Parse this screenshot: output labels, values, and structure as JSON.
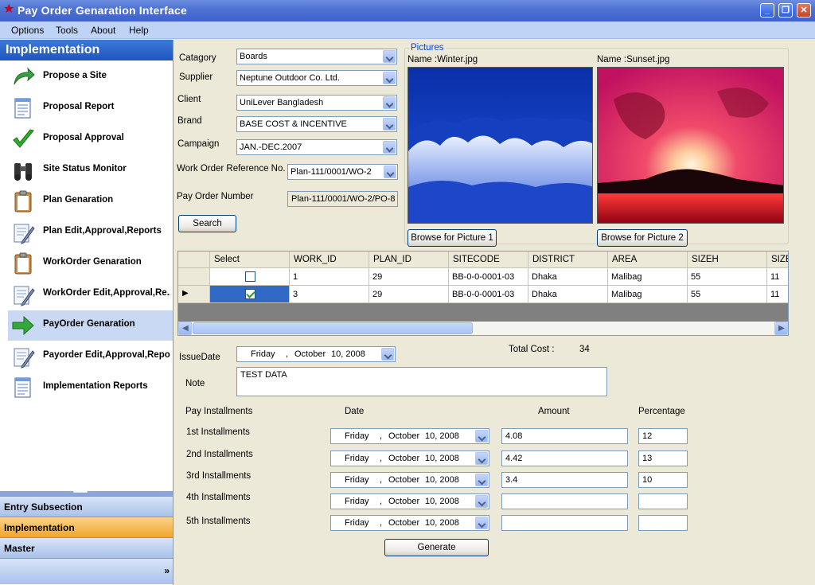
{
  "window": {
    "title": "Pay Order Genaration Interface"
  },
  "menu": [
    "Options",
    "Tools",
    "About",
    "Help"
  ],
  "sidebar": {
    "header": "Implementation",
    "items": [
      {
        "label": "Propose a Site",
        "icon": "green-curved-arrow-icon"
      },
      {
        "label": "Proposal Report",
        "icon": "report-document-icon"
      },
      {
        "label": "Proposal Approval",
        "icon": "green-checkmark-icon"
      },
      {
        "label": "Site Status Monitor",
        "icon": "binoculars-icon"
      },
      {
        "label": "Plan Genaration",
        "icon": "clipboard-icon"
      },
      {
        "label": "Plan Edit,Approval,Reports",
        "icon": "edit-document-icon"
      },
      {
        "label": "WorkOrder Genaration",
        "icon": "clipboard-icon"
      },
      {
        "label": "WorkOrder Edit,Approval,Re...",
        "icon": "edit-document-icon"
      },
      {
        "label": "PayOrder Genaration",
        "icon": "green-right-arrow-icon"
      },
      {
        "label": "Payorder Edit,Approval,Repo...",
        "icon": "edit-document-icon"
      },
      {
        "label": "Implementation Reports",
        "icon": "report-document-icon"
      }
    ],
    "active_index": 8,
    "groups": [
      "Entry Subsection",
      "Implementation",
      "Master"
    ],
    "active_group": 1
  },
  "form": {
    "category": {
      "label": "Catagory",
      "value": "Boards"
    },
    "supplier": {
      "label": "Supplier",
      "value": "Neptune Outdoor Co. Ltd."
    },
    "client": {
      "label": "Client",
      "value": "UniLever Bangladesh"
    },
    "brand": {
      "label": "Brand",
      "value": "BASE COST & INCENTIVE"
    },
    "campaign": {
      "label": "Campaign",
      "value": "JAN.-DEC.2007"
    },
    "work_order_ref": {
      "label": "Work Order Reference No.",
      "value": "Plan-111/0001/WO-2"
    },
    "pay_order_number": {
      "label": "Pay Order Number",
      "value": "Plan-111/0001/WO-2/PO-8"
    },
    "search_label": "Search"
  },
  "pictures": {
    "title": "Pictures",
    "pic1": {
      "name": "Name :Winter.jpg",
      "button": "Browse for Picture 1"
    },
    "pic2": {
      "name": "Name :Sunset.jpg",
      "button": "Browse for Picture 2"
    }
  },
  "grid": {
    "columns": [
      "Select",
      "WORK_ID",
      "PLAN_ID",
      "SITECODE",
      "DISTRICT",
      "AREA",
      "SIZEH",
      "SIZE"
    ],
    "rows": [
      {
        "selected": false,
        "work_id": "1",
        "plan_id": "29",
        "sitecode": "BB-0-0-0001-03",
        "district": "Dhaka",
        "area": "Malibag",
        "sizeh": "55",
        "sizew": "11"
      },
      {
        "selected": true,
        "work_id": "3",
        "plan_id": "29",
        "sitecode": "BB-0-0-0001-03",
        "district": "Dhaka",
        "area": "Malibag",
        "sizeh": "55",
        "sizew": "11"
      }
    ]
  },
  "issue": {
    "date_label": "IssueDate",
    "date": {
      "day": "Friday",
      "sep": ",",
      "month": "October",
      "rest": "10, 2008"
    },
    "total_cost_label": "Total Cost :",
    "total_cost": "34",
    "note_label": "Note",
    "note": "TEST DATA"
  },
  "installments": {
    "header_label": "Pay Installments",
    "date_header": "Date",
    "amount_header": "Amount",
    "percentage_header": "Percentage",
    "rows": [
      {
        "label": "1st Installments",
        "day": "Friday",
        "sep": ",",
        "month": "October",
        "rest": "10, 2008",
        "amount": "4.08",
        "percentage": "12"
      },
      {
        "label": "2nd Installments",
        "day": "Friday",
        "sep": ",",
        "month": "October",
        "rest": "10, 2008",
        "amount": "4.42",
        "percentage": "13"
      },
      {
        "label": "3rd Installments",
        "day": "Friday",
        "sep": ",",
        "month": "October",
        "rest": "10, 2008",
        "amount": "3.4",
        "percentage": "10"
      },
      {
        "label": "4th Installments",
        "day": "Friday",
        "sep": ",",
        "month": "October",
        "rest": "10, 2008",
        "amount": "",
        "percentage": ""
      },
      {
        "label": "5th Installments",
        "day": "Friday",
        "sep": ",",
        "month": "October",
        "rest": "10, 2008",
        "amount": "",
        "percentage": ""
      }
    ],
    "generate_label": "Generate"
  }
}
